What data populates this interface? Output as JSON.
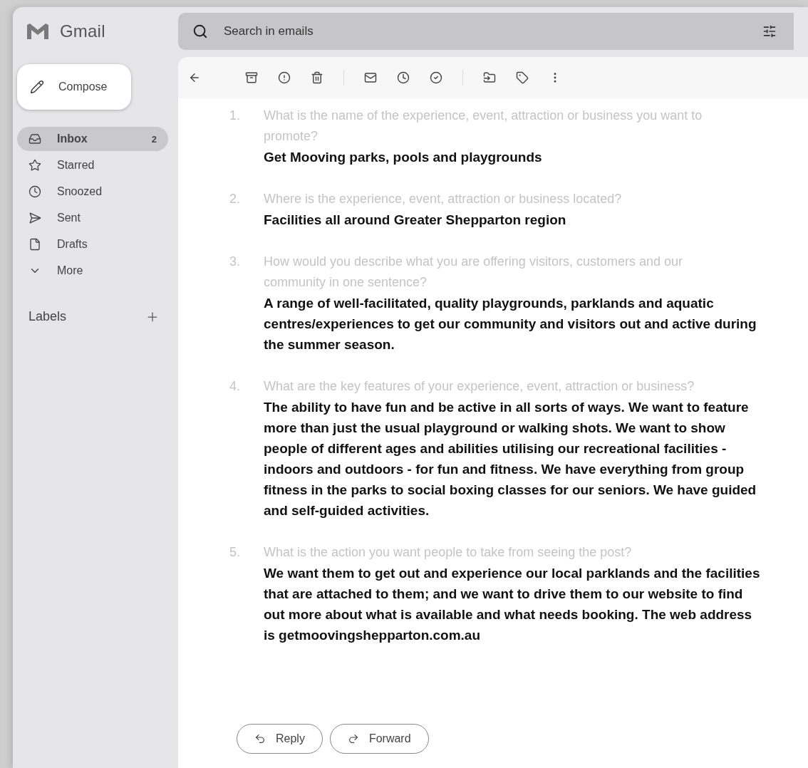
{
  "app": {
    "name": "Gmail"
  },
  "search": {
    "placeholder": "Search in emails"
  },
  "compose": {
    "label": "Compose"
  },
  "sidebar": {
    "items": [
      {
        "kind": "inbox",
        "label": "Inbox",
        "count": "2",
        "selected": true
      },
      {
        "kind": "starred",
        "label": "Starred",
        "selected": false
      },
      {
        "kind": "snoozed",
        "label": "Snoozed",
        "selected": false
      },
      {
        "kind": "sent",
        "label": "Sent",
        "selected": false
      },
      {
        "kind": "drafts",
        "label": "Drafts",
        "selected": false
      },
      {
        "kind": "more",
        "label": "More",
        "selected": false
      }
    ],
    "labels_heading": "Labels"
  },
  "message": {
    "items": [
      {
        "number": "1.",
        "question": "What is the name of the experience, event, attraction or business you want to promote?",
        "answer": "Get Mooving parks, pools and playgrounds"
      },
      {
        "number": "2.",
        "question": "Where is the experience, event, attraction or business located?",
        "answer": "Facilities all around Greater Shepparton region"
      },
      {
        "number": "3.",
        "question": "How would you describe what you are offering visitors, customers and our community in one sentence?",
        "answer": "A range of well-facilitated, quality playgrounds, parklands and aquatic centres/experiences to get our community and visitors out and active during the summer season."
      },
      {
        "number": "4.",
        "question": "What are the key features of your experience, event, attraction or business?",
        "answer": "The ability to have fun and be active in all sorts of ways. We want to feature more than just the usual playground or walking shots. We want to show people of different ages and abilities utilising our recreational facilities - indoors and outdoors - for fun and fitness. We have everything from group fitness in the parks to social boxing classes for our seniors. We have guided and self-guided activities."
      },
      {
        "number": "5.",
        "question": "What is the action you want people to take from seeing the post?",
        "answer": "We want them to get out and experience our local parklands and the facilities that are attached to them; and we want to drive them to our website to find out more about what is available and what needs booking. The web address is getmoovingshepparton.com.au"
      }
    ]
  },
  "actions": [
    {
      "kind": "reply",
      "label": "Reply"
    },
    {
      "kind": "forward",
      "label": "Forward"
    }
  ]
}
